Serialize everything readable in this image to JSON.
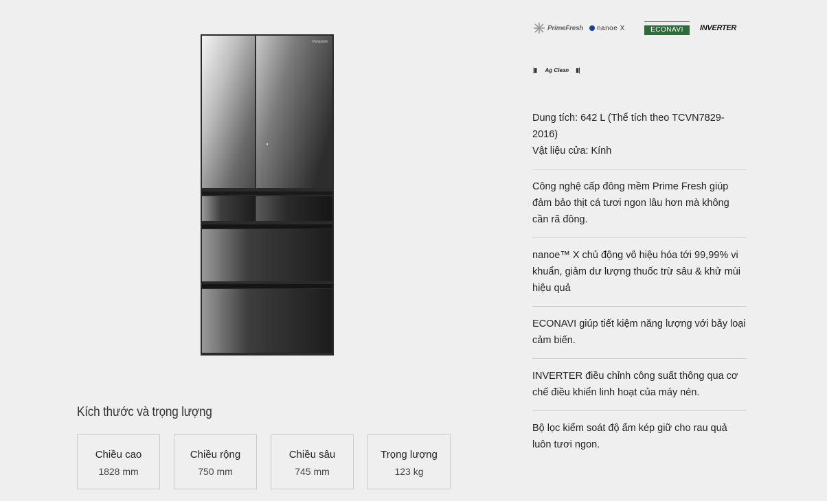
{
  "product": {
    "image_alt": "Panasonic refrigerator",
    "brand_mark": "Panasonic"
  },
  "dimensions": {
    "title": "Kích thước và trọng lượng",
    "items": [
      {
        "label": "Chiều cao",
        "value": "1828 mm"
      },
      {
        "label": "Chiều rộng",
        "value": "750 mm"
      },
      {
        "label": "Chiều sâu",
        "value": "745 mm"
      },
      {
        "label": "Trọng lượng",
        "value": "123 kg"
      }
    ]
  },
  "logos": {
    "prime_fresh": "PrimeFresh",
    "nanoe": "nanoe X",
    "econavi": "ECONAVI",
    "inverter": "INVERTER",
    "ag_clean": "Ag Clean"
  },
  "features": [
    {
      "lines": [
        "Dung tích: 642 L (Thể tích theo TCVN7829-2016)",
        "Vật liệu cửa: Kính"
      ]
    },
    {
      "lines": [
        "Công nghệ cấp đông mềm Prime Fresh giúp đảm bảo thịt cá tươi ngon lâu hơn mà không cần rã đông."
      ]
    },
    {
      "lines": [
        "nanoe™ X chủ động vô hiệu hóa tới 99,99% vi khuẩn, giảm dư lượng thuốc trừ sâu & khử mùi hiệu quả"
      ]
    },
    {
      "lines": [
        "ECONAVI giúp tiết kiệm năng lượng với bảy loại cảm biến."
      ]
    },
    {
      "lines": [
        "INVERTER điều chỉnh công suất thông qua cơ chế điều khiển linh hoạt của máy nén."
      ]
    },
    {
      "lines": [
        "Bộ lọc kiểm soát độ ẩm kép giữ cho rau quả luôn tươi ngon."
      ]
    }
  ],
  "colors": {
    "background": "#efefef",
    "econavi_green": "#2f6b3a",
    "nanoe_blue": "#1d3f8f"
  }
}
